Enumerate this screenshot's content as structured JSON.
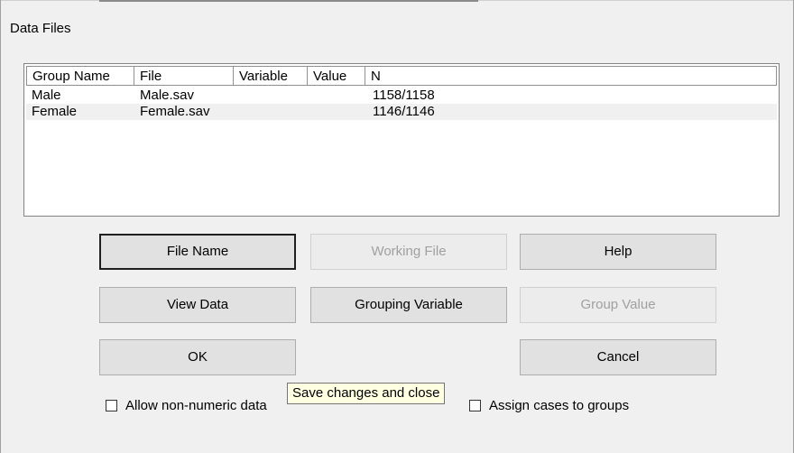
{
  "window": {
    "title": "Data Files"
  },
  "table": {
    "columns": [
      "Group Name",
      "File",
      "Variable",
      "Value",
      "N"
    ],
    "rows": [
      {
        "group": "Male",
        "file": "Male.sav",
        "variable": "",
        "value": "",
        "n": "1158/1158"
      },
      {
        "group": "Female",
        "file": "Female.sav",
        "variable": "",
        "value": "",
        "n": "1146/1146"
      }
    ]
  },
  "buttons": {
    "file_name": "File Name",
    "working_file": "Working File",
    "help": "Help",
    "view_data": "View Data",
    "grouping_variable": "Grouping Variable",
    "group_value": "Group Value",
    "ok": "OK",
    "cancel": "Cancel"
  },
  "checkboxes": {
    "allow_non_numeric": "Allow non-numeric data",
    "assign_cases": "Assign cases to groups"
  },
  "tooltip": {
    "text": "Save changes and close"
  },
  "colors": {
    "tooltip_bg": "#ffffe1",
    "row_alt": "#f0f0f0",
    "dialog_bg": "#f0f0f0"
  }
}
